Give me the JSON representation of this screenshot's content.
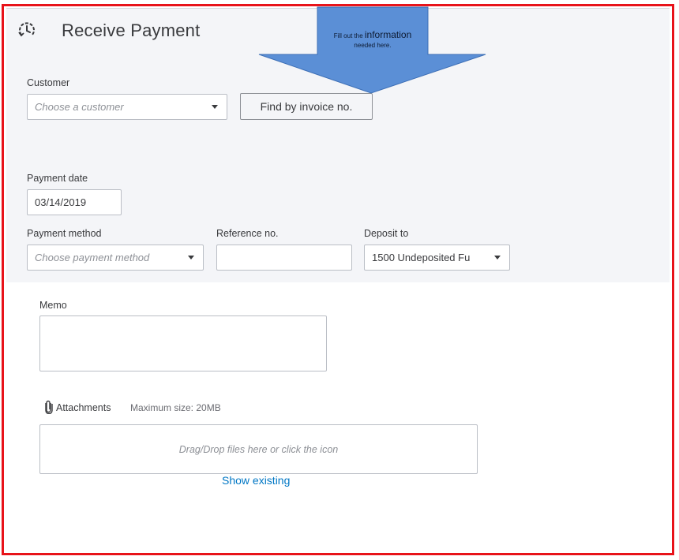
{
  "header": {
    "title": "Receive Payment",
    "icon": "clock-refresh-icon"
  },
  "callout": {
    "text_small_prefix": "Fill out the",
    "text_big": "information",
    "text_line2": "needed here.",
    "fill_color": "#5b8fd6"
  },
  "customer": {
    "label": "Customer",
    "placeholder": "Choose a customer",
    "find_button_label": "Find by invoice no."
  },
  "payment_date": {
    "label": "Payment date",
    "value": "03/14/2019"
  },
  "payment_method": {
    "label": "Payment method",
    "placeholder": "Choose payment method"
  },
  "reference": {
    "label": "Reference no.",
    "value": ""
  },
  "deposit_to": {
    "label": "Deposit to",
    "value": "1500 Undeposited Fu"
  },
  "memo": {
    "label": "Memo",
    "value": ""
  },
  "attachments": {
    "label": "Attachments",
    "max_size": "Maximum size: 20MB",
    "dropzone_text": "Drag/Drop files here or click the icon",
    "show_existing_label": "Show existing"
  },
  "colors": {
    "frame_border": "#e8131a",
    "top_band": "#f4f5f8",
    "link": "#0077c5"
  }
}
